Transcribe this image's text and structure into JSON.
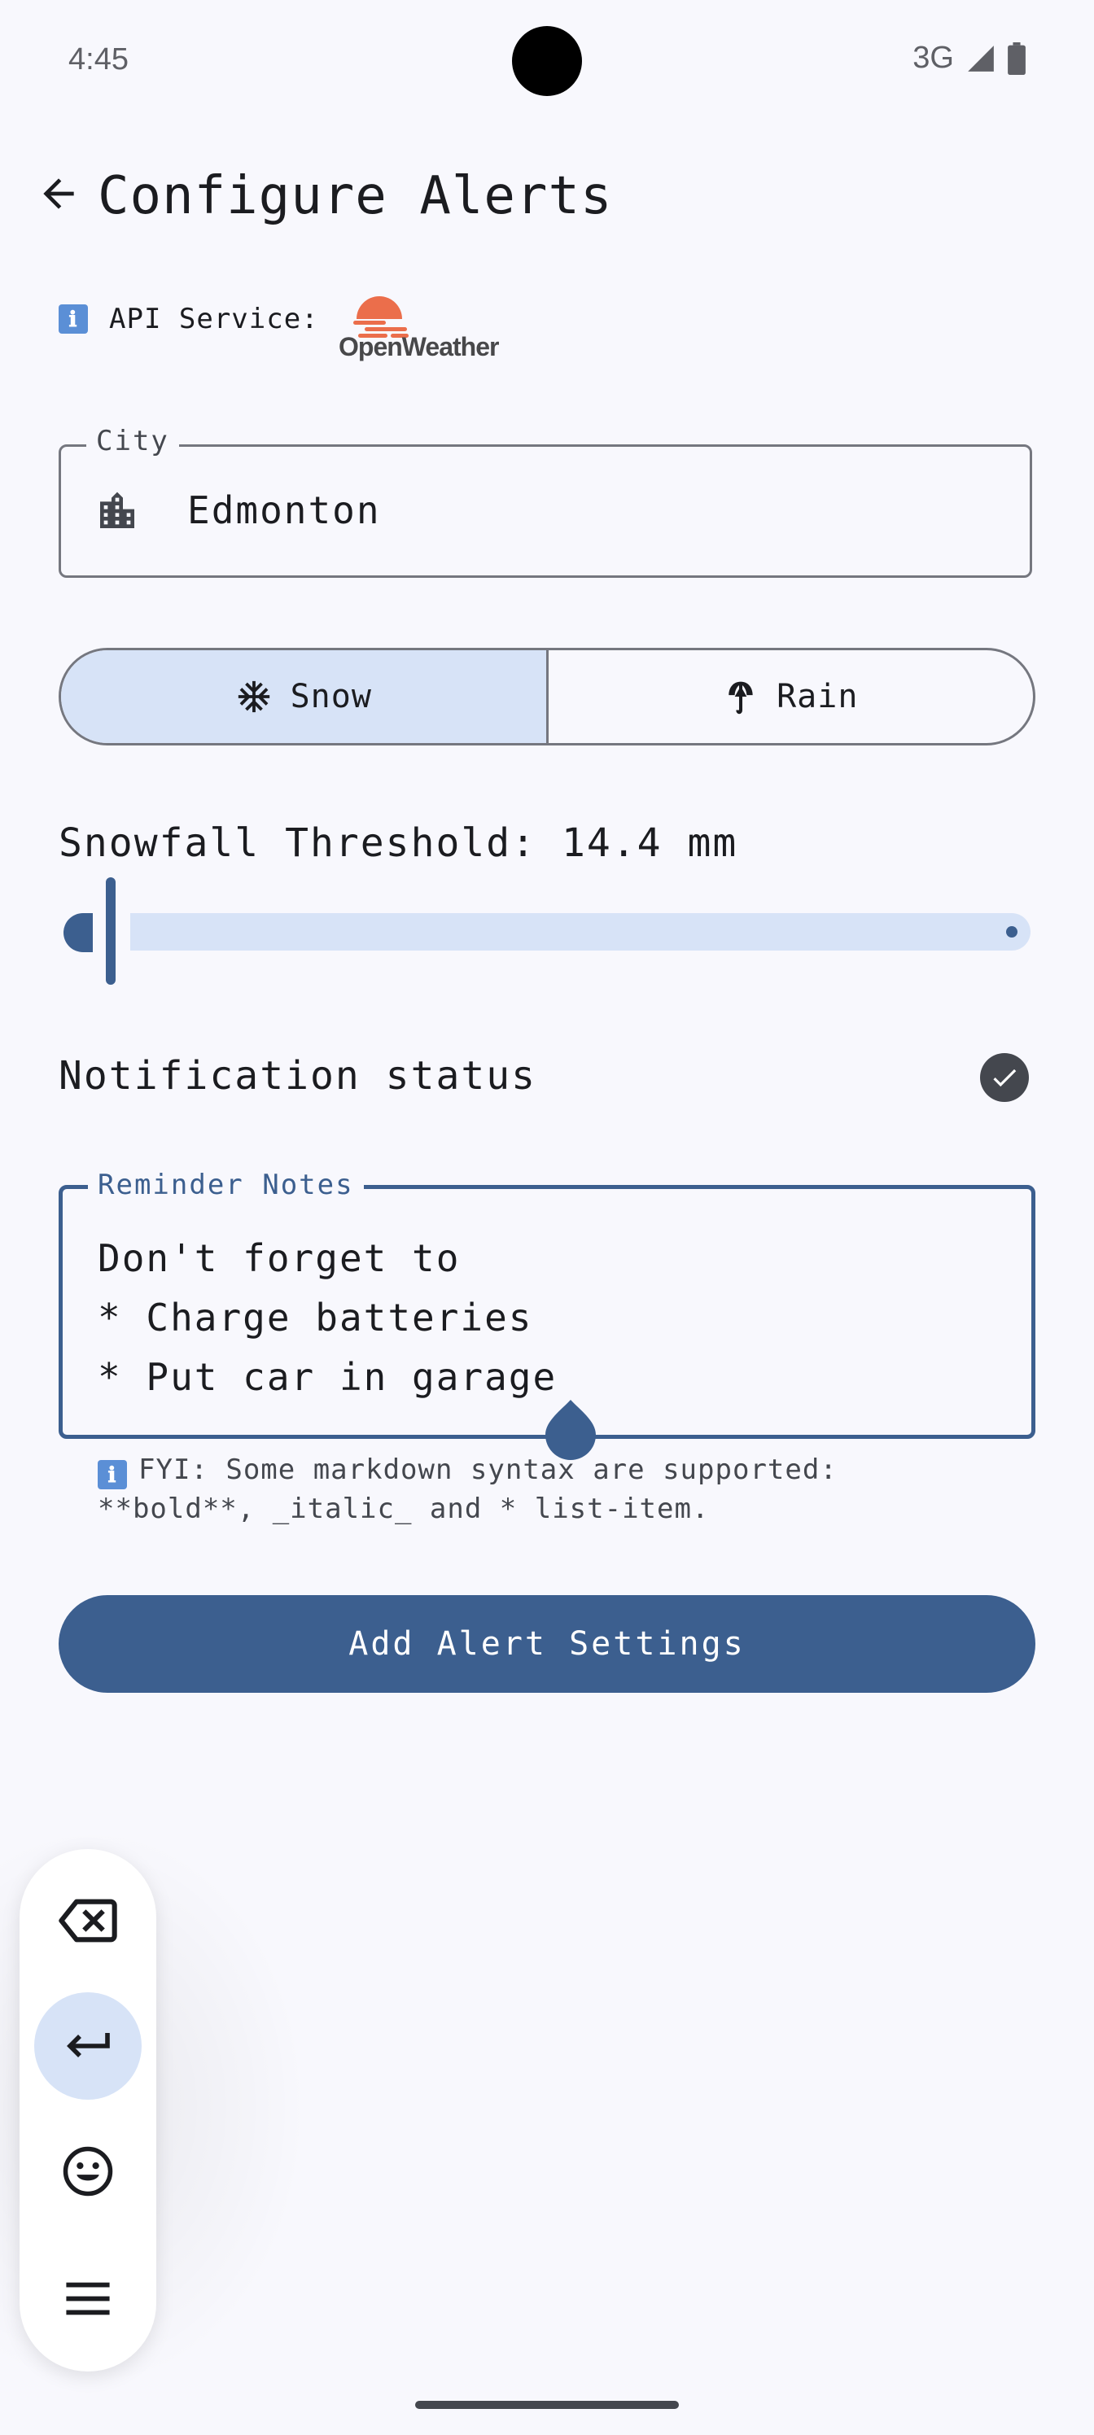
{
  "status_bar": {
    "time": "4:45",
    "network": "3G",
    "icons": [
      "signal-icon",
      "battery-icon"
    ]
  },
  "header": {
    "title": "Configure Alerts",
    "back_icon": "arrow-left-icon"
  },
  "api": {
    "label": "API Service:",
    "info_icon": "ℹ",
    "provider_logo_text": "OpenWeather"
  },
  "city": {
    "label": "City",
    "value": "Edmonton",
    "icon": "city-buildings-icon"
  },
  "weather_type": {
    "options": [
      {
        "label": "Snow",
        "icon": "snowflake-icon",
        "selected": true
      },
      {
        "label": "Rain",
        "icon": "umbrella-icon",
        "selected": false
      }
    ]
  },
  "threshold": {
    "label": "Snowfall Threshold: 14.4 mm",
    "slider_fraction": 0.02
  },
  "notification": {
    "label": "Notification status",
    "checked": true
  },
  "notes": {
    "label": "Reminder Notes",
    "value": "Don't forget to\n* Charge batteries\n* Put car in garage",
    "info_icon": "ℹ",
    "hint": "FYI: Some markdown syntax are supported: **bold**, _italic_ and * list-item."
  },
  "primary_action": {
    "label": "Add Alert Settings"
  },
  "floating_keyboard_toolbar": {
    "items": [
      "backspace-icon",
      "enter-icon",
      "emoji-icon",
      "menu-icon"
    ]
  },
  "colors": {
    "primary": "#3c5f8f",
    "primary_container": "#d7e3f7",
    "background": "#f8f8fd",
    "openweather_orange": "#eb6e4b"
  }
}
